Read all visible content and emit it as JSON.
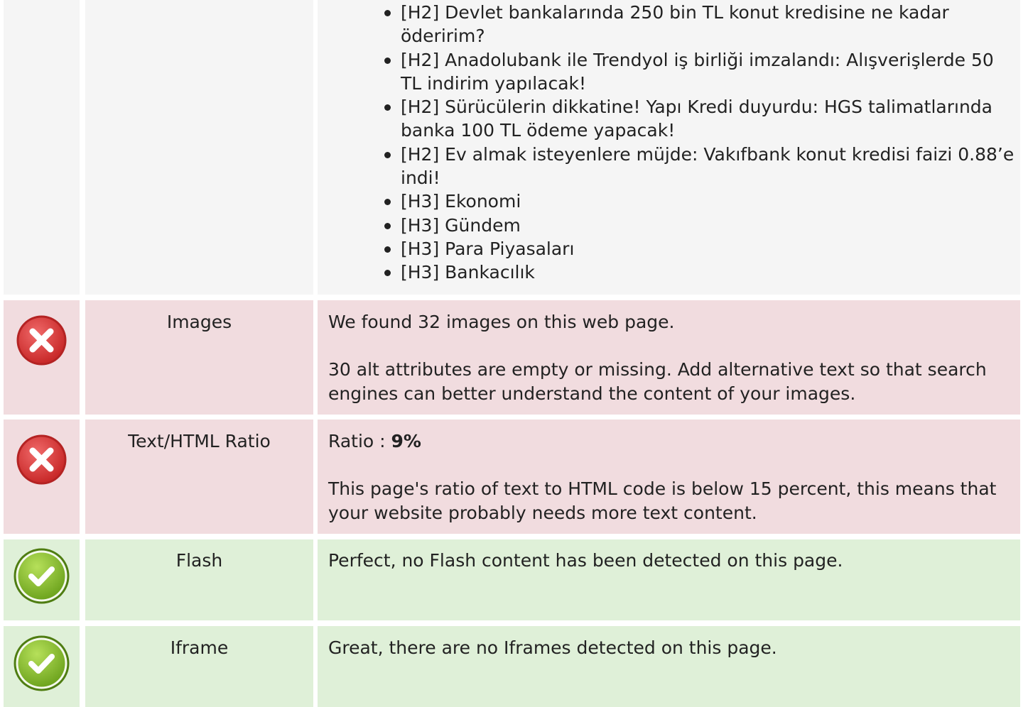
{
  "headings": {
    "items": [
      "[H2] Devlet bankalarında 250 bin TL konut kredisine ne kadar öderirim?",
      "[H2] Anadolubank ile Trendyol iş birliği imzalandı: Alışverişlerde 50 TL indirim yapılacak!",
      "[H2] Sürücülerin dikkatine! Yapı Kredi duyurdu: HGS talimatlarında banka 100 TL ödeme yapacak!",
      "[H2] Ev almak isteyenlere müjde: Vakıfbank konut kredisi faizi 0.88’e indi!",
      "[H3] Ekonomi",
      "[H3] Gündem",
      "[H3] Para Piyasaları",
      "[H3] Bankacılık"
    ]
  },
  "images": {
    "label": "Images",
    "status": "error",
    "line1": "We found 32 images on this web page.",
    "line2": "30 alt attributes are empty or missing. Add alternative text so that search engines can better understand the content of your images."
  },
  "ratio": {
    "label": "Text/HTML Ratio",
    "status": "error",
    "prefix": "Ratio : ",
    "value": "9%",
    "line2": "This page's ratio of text to HTML code is below 15 percent, this means that your website probably needs more text content."
  },
  "flash": {
    "label": "Flash",
    "status": "ok",
    "line1": "Perfect, no Flash content has been detected on this page."
  },
  "iframe": {
    "label": "Iframe",
    "status": "ok",
    "line1": "Great, there are no Iframes detected on this page."
  },
  "colors": {
    "error_bg": "#f1dcdf",
    "ok_bg": "#dff0d8",
    "neutral_bg": "#f5f5f5",
    "error_icon": "#dd3b3b",
    "ok_icon": "#8cc43a"
  },
  "icons": {
    "error": "x-circle-icon",
    "ok": "check-circle-icon"
  }
}
